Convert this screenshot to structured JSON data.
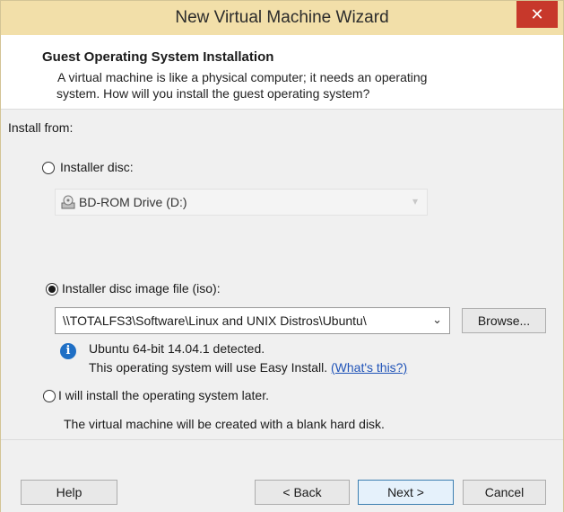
{
  "window": {
    "title": "New Virtual Machine Wizard",
    "close_glyph": "✕"
  },
  "header": {
    "title": "Guest Operating System Installation",
    "description_line1": "A virtual machine is like a physical computer; it needs an operating",
    "description_line2": "system. How will you install the guest operating system?"
  },
  "install_from_label": "Install from:",
  "options": {
    "disc": {
      "label": "Installer disc:",
      "selected": false,
      "drive": "BD-ROM Drive (D:)"
    },
    "iso": {
      "label": "Installer disc image file (iso):",
      "selected": true,
      "path": "\\\\TOTALFS3\\Software\\Linux and UNIX Distros\\Ubuntu\\",
      "browse_label": "Browse..."
    },
    "later": {
      "label": "I will install the operating system later.",
      "selected": false,
      "note": "The virtual machine will be created with a blank hard disk."
    }
  },
  "detection": {
    "line1": "Ubuntu 64-bit 14.04.1 detected.",
    "line2": "This operating system will use Easy Install.",
    "link": "(What's this?)"
  },
  "footer": {
    "help": "Help",
    "back": "< Back",
    "next": "Next >",
    "cancel": "Cancel"
  },
  "colors": {
    "titlebar": "#f2dfa9",
    "close": "#c7382b",
    "link": "#1f53b8",
    "info": "#1f6fc5"
  }
}
